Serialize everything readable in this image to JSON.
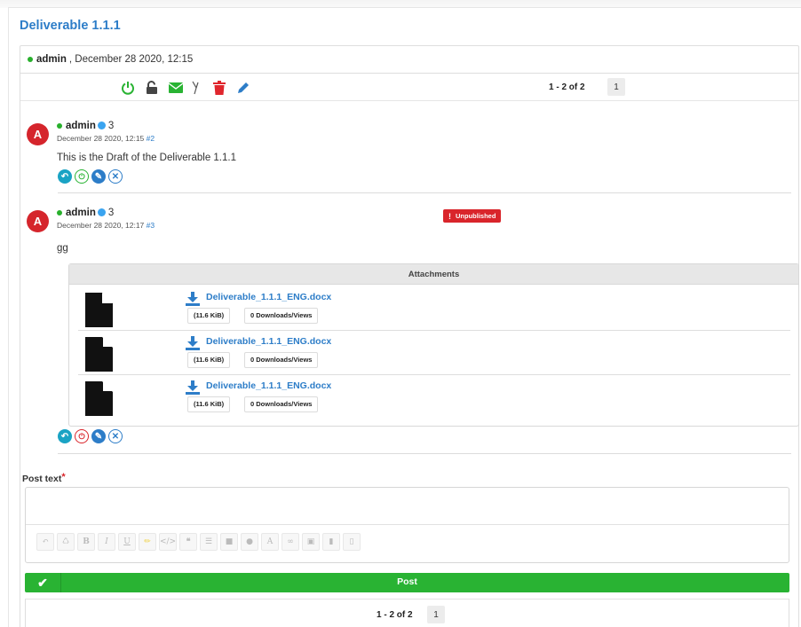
{
  "topic": {
    "title": "Deliverable 1.1.1",
    "author": "admin",
    "date": ", December 28 2020, 12:15"
  },
  "toolbar": {
    "icons": [
      "power-icon",
      "unlock-icon",
      "envelope-icon",
      "split-icon",
      "trash-icon",
      "pencil-icon"
    ],
    "pager_text": "1 - 2 of 2",
    "page": "1"
  },
  "posts": [
    {
      "avatar": "A",
      "author": "admin",
      "rank": "3",
      "date": "December 28 2020, 12:15",
      "anchor": "#2",
      "text": "This is the Draft of the Deliverable 1.1.1"
    },
    {
      "avatar": "A",
      "author": "admin",
      "rank": "3",
      "date": "December 28 2020, 12:17",
      "anchor": "#3",
      "text": "gg",
      "badge": "Unpublished"
    }
  ],
  "attachments": {
    "header": "Attachments",
    "items": [
      {
        "name": "Deliverable_1.1.1_ENG.docx",
        "size": "(11.6 KiB)",
        "downloads": "0 Downloads/Views"
      },
      {
        "name": "Deliverable_1.1.1_ENG.docx",
        "size": "(11.6 KiB)",
        "downloads": "0 Downloads/Views"
      },
      {
        "name": "Deliverable_1.1.1_ENG.docx",
        "size": "(11.6 KiB)",
        "downloads": "0 Downloads/Views"
      }
    ]
  },
  "form": {
    "label": "Post text",
    "required_mark": "*",
    "editor_tools": [
      "undo",
      "recycle",
      "B",
      "I",
      "U",
      "highlight",
      "code",
      "quote",
      "list",
      "lock",
      "circle",
      "A",
      "link",
      "image",
      "file",
      "clear"
    ],
    "post_label": "Post"
  },
  "footer": {
    "pager_text": "1 - 2 of 2",
    "page": "1"
  },
  "colors": {
    "accent": "#2d7dc8",
    "success": "#29b333",
    "danger": "#d9252b"
  }
}
